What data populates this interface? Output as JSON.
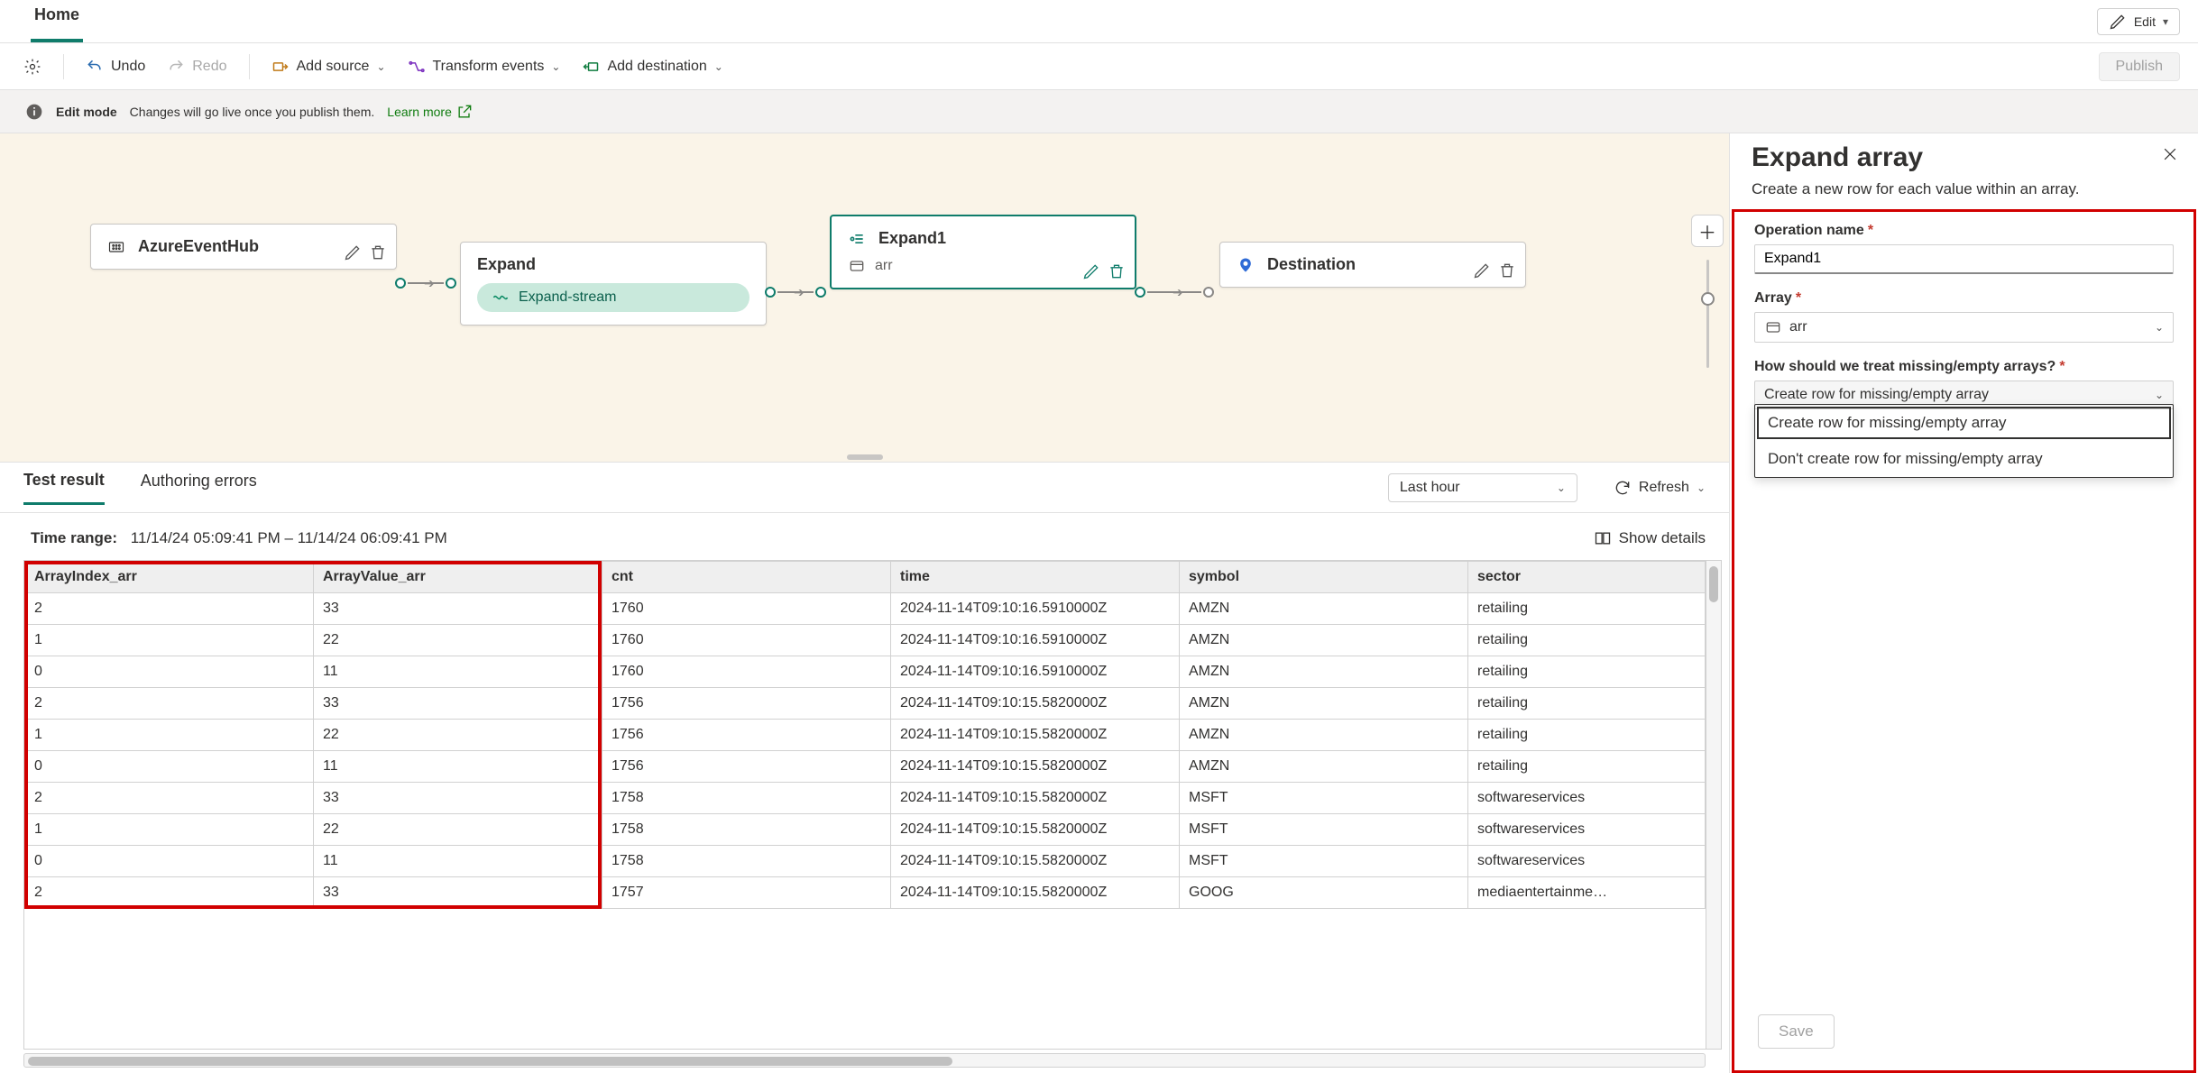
{
  "tabs": {
    "home": "Home"
  },
  "edit_button": {
    "label": "Edit"
  },
  "cmdbar": {
    "undo": "Undo",
    "redo": "Redo",
    "add_source": "Add source",
    "transform": "Transform events",
    "add_destination": "Add destination",
    "publish": "Publish"
  },
  "infobar": {
    "mode_label": "Edit mode",
    "desc": "Changes will go live once you publish them.",
    "learn_more": "Learn more"
  },
  "canvas": {
    "node_source": {
      "title": "AzureEventHub"
    },
    "node_expand_mid": {
      "title": "Expand",
      "chip": "Expand-stream"
    },
    "node_expand1": {
      "title": "Expand1",
      "sub": "arr"
    },
    "node_dest": {
      "title": "Destination"
    }
  },
  "results": {
    "tab_test": "Test result",
    "tab_errors": "Authoring errors",
    "time_selector": "Last hour",
    "refresh": "Refresh",
    "time_range_label": "Time range:",
    "time_range_value": "11/14/24 05:09:41 PM  –  11/14/24 06:09:41 PM",
    "show_details": "Show details",
    "columns": [
      "ArrayIndex_arr",
      "ArrayValue_arr",
      "cnt",
      "time",
      "symbol",
      "sector"
    ],
    "rows": [
      [
        "2",
        "33",
        "1760",
        "2024-11-14T09:10:16.5910000Z",
        "AMZN",
        "retailing"
      ],
      [
        "1",
        "22",
        "1760",
        "2024-11-14T09:10:16.5910000Z",
        "AMZN",
        "retailing"
      ],
      [
        "0",
        "11",
        "1760",
        "2024-11-14T09:10:16.5910000Z",
        "AMZN",
        "retailing"
      ],
      [
        "2",
        "33",
        "1756",
        "2024-11-14T09:10:15.5820000Z",
        "AMZN",
        "retailing"
      ],
      [
        "1",
        "22",
        "1756",
        "2024-11-14T09:10:15.5820000Z",
        "AMZN",
        "retailing"
      ],
      [
        "0",
        "11",
        "1756",
        "2024-11-14T09:10:15.5820000Z",
        "AMZN",
        "retailing"
      ],
      [
        "2",
        "33",
        "1758",
        "2024-11-14T09:10:15.5820000Z",
        "MSFT",
        "softwareservices"
      ],
      [
        "1",
        "22",
        "1758",
        "2024-11-14T09:10:15.5820000Z",
        "MSFT",
        "softwareservices"
      ],
      [
        "0",
        "11",
        "1758",
        "2024-11-14T09:10:15.5820000Z",
        "MSFT",
        "softwareservices"
      ],
      [
        "2",
        "33",
        "1757",
        "2024-11-14T09:10:15.5820000Z",
        "GOOG",
        "mediaentertainme…"
      ]
    ]
  },
  "panel": {
    "title": "Expand array",
    "desc": "Create a new row for each value within an array.",
    "operation_name_label": "Operation name",
    "operation_name_value": "Expand1",
    "array_label": "Array",
    "array_value": "arr",
    "treat_label": "How should we treat missing/empty arrays?",
    "treat_value": "Create row for missing/empty array",
    "options": [
      "Create row for missing/empty array",
      "Don't create row for missing/empty array"
    ],
    "save": "Save"
  }
}
